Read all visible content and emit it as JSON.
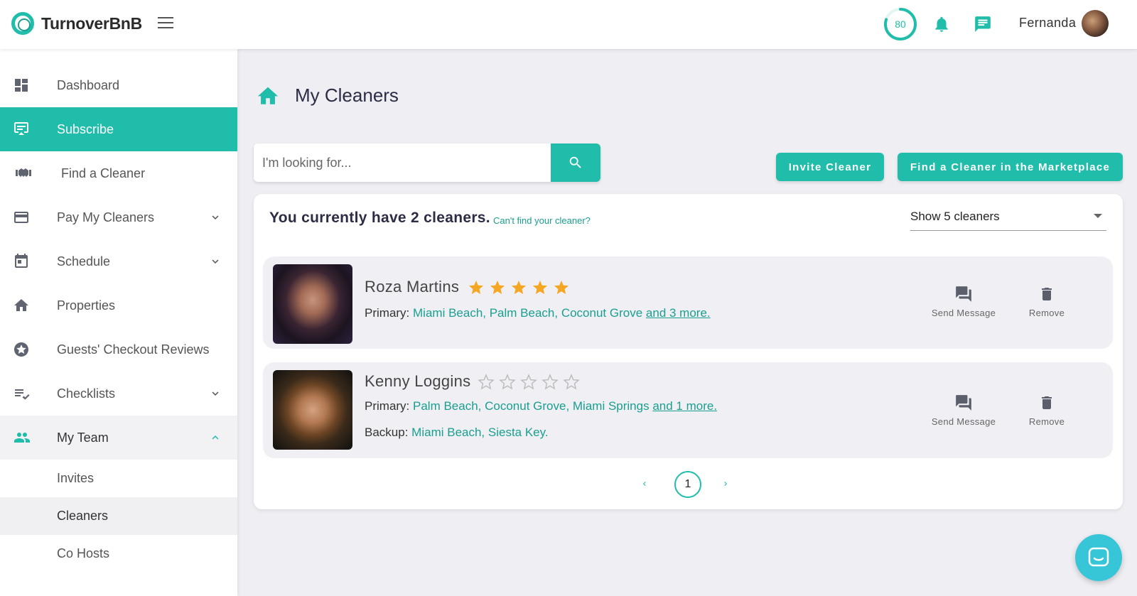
{
  "app": {
    "name": "TurnoverBnB"
  },
  "header": {
    "score": "80",
    "user_name": "Fernanda"
  },
  "sidebar": {
    "items": [
      {
        "label": "Dashboard",
        "icon": "dashboard-icon"
      },
      {
        "label": "Subscribe",
        "icon": "subscribe-icon"
      },
      {
        "label": "Find a Cleaner",
        "icon": "handshake-icon"
      },
      {
        "label": "Pay My Cleaners",
        "icon": "credit-card-icon"
      },
      {
        "label": "Schedule",
        "icon": "calendar-icon"
      },
      {
        "label": "Properties",
        "icon": "home-icon"
      },
      {
        "label": "Guests' Checkout Reviews",
        "icon": "star-badge-icon"
      },
      {
        "label": "Checklists",
        "icon": "checklist-icon"
      },
      {
        "label": "My Team",
        "icon": "team-icon"
      }
    ],
    "subitems": [
      {
        "label": "Invites"
      },
      {
        "label": "Cleaners"
      },
      {
        "label": "Co Hosts"
      }
    ]
  },
  "main": {
    "title": "My Cleaners",
    "search": {
      "placeholder": "I'm looking for..."
    },
    "buttons": {
      "invite": "Invite Cleaner",
      "marketplace": "Find a Cleaner in the Marketplace"
    },
    "card": {
      "heading": "You currently have 2 cleaners.",
      "cant_find": "Can't find your cleaner?",
      "show_select": "Show 5 cleaners"
    },
    "cleaners": [
      {
        "name": "Roza Martins",
        "rating": 5,
        "primary_label": "Primary:",
        "primary_areas": "Miami Beach, Palm Beach, Coconut Grove",
        "primary_more": "and 3 more.",
        "send_message": "Send Message",
        "remove": "Remove"
      },
      {
        "name": "Kenny Loggins",
        "rating": 0,
        "primary_label": "Primary:",
        "primary_areas": "Palm Beach, Coconut Grove, Miami Springs",
        "primary_more": "and 1 more.",
        "backup_label": "Backup:",
        "backup_areas": "Miami Beach, Siesta Key.",
        "send_message": "Send Message",
        "remove": "Remove"
      }
    ],
    "pagination": {
      "current_page": "1"
    }
  },
  "colors": {
    "accent": "#1fbdaa",
    "accent_text": "#1a9e8f",
    "star_filled": "#f5a623",
    "star_empty": "#bdbdbd",
    "chat_fab": "#36c6d8"
  }
}
